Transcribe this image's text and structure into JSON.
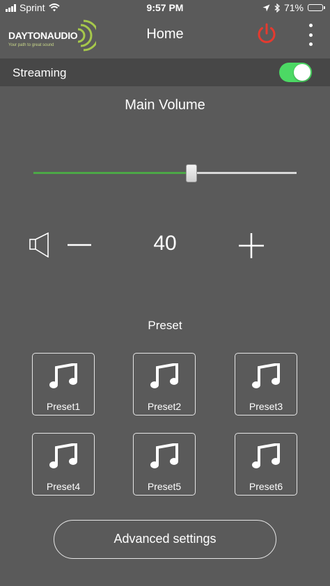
{
  "status_bar": {
    "carrier": "Sprint",
    "time": "9:57 PM",
    "battery_percent": "71%",
    "battery_level": 0.71,
    "icons": [
      "signal-bars-icon",
      "wifi-icon",
      "location-arrow-icon",
      "bluetooth-icon",
      "battery-icon"
    ]
  },
  "header": {
    "logo_text": "DAYTONAUDIO",
    "logo_tagline": "Your path to great sound",
    "title": "Home",
    "power_icon": "power-icon",
    "menu_icon": "vertical-dots-icon"
  },
  "streaming": {
    "label": "Streaming",
    "enabled": true
  },
  "volume": {
    "title": "Main Volume",
    "value": "40",
    "level": 0.6,
    "icons": [
      "speaker-icon",
      "minus-icon",
      "plus-icon"
    ]
  },
  "preset": {
    "title": "Preset",
    "icon": "music-note-icon",
    "items": [
      {
        "label": "Preset1"
      },
      {
        "label": "Preset2"
      },
      {
        "label": "Preset3"
      },
      {
        "label": "Preset4"
      },
      {
        "label": "Preset5"
      },
      {
        "label": "Preset6"
      }
    ]
  },
  "advanced_settings": {
    "label": "Advanced settings"
  },
  "colors": {
    "background": "#5a5a5a",
    "streaming_bar": "#474747",
    "toggle_on": "#4cd964",
    "slider_fill": "#4ca847",
    "power": "#e53a2f",
    "logo_accent": "#a6c84b"
  }
}
